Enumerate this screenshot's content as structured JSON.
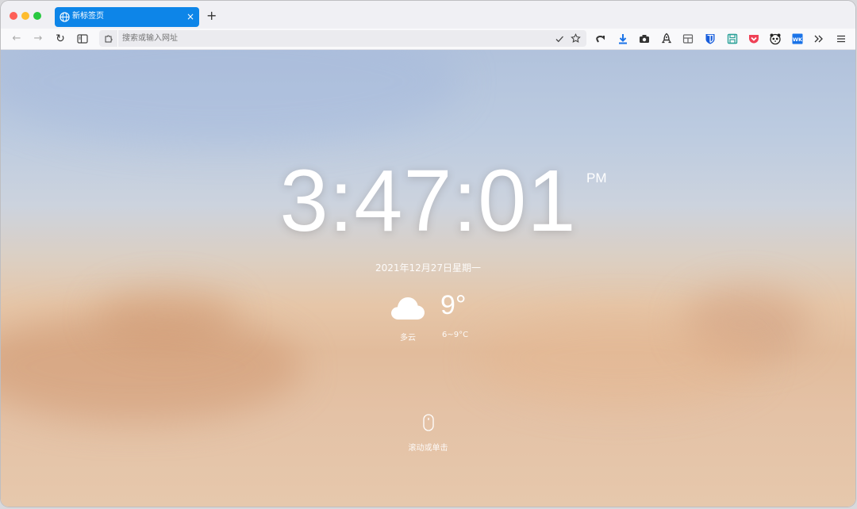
{
  "browser": {
    "tab": {
      "title": "新标签页",
      "close": "×"
    },
    "new_tab": "+",
    "nav": {
      "back": "←",
      "forward": "→",
      "reload": "↻"
    },
    "address": {
      "placeholder": "搜索或输入网址",
      "value": ""
    },
    "extensions": [
      "undo-icon",
      "download-icon",
      "camera-icon",
      "rocket-icon",
      "tab-grid-icon",
      "bitwarden-icon",
      "save-icon",
      "pocket-icon",
      "panda-icon",
      "wk-icon",
      "overflow-icon",
      "menu-icon"
    ],
    "colors": {
      "tab": "#0d85e8",
      "download": "#1a73e8",
      "bitwarden": "#175ddc",
      "pocket": "#ef4056",
      "save": "#2aa198"
    }
  },
  "newtab": {
    "time": "3:47:01",
    "ampm": "PM",
    "date": "2021年12月27日星期一",
    "weather": {
      "icon": "cloud-icon",
      "temperature": "9°",
      "condition": "多云",
      "range": "6~9°C"
    },
    "scroll_hint": "滚动或单击"
  }
}
